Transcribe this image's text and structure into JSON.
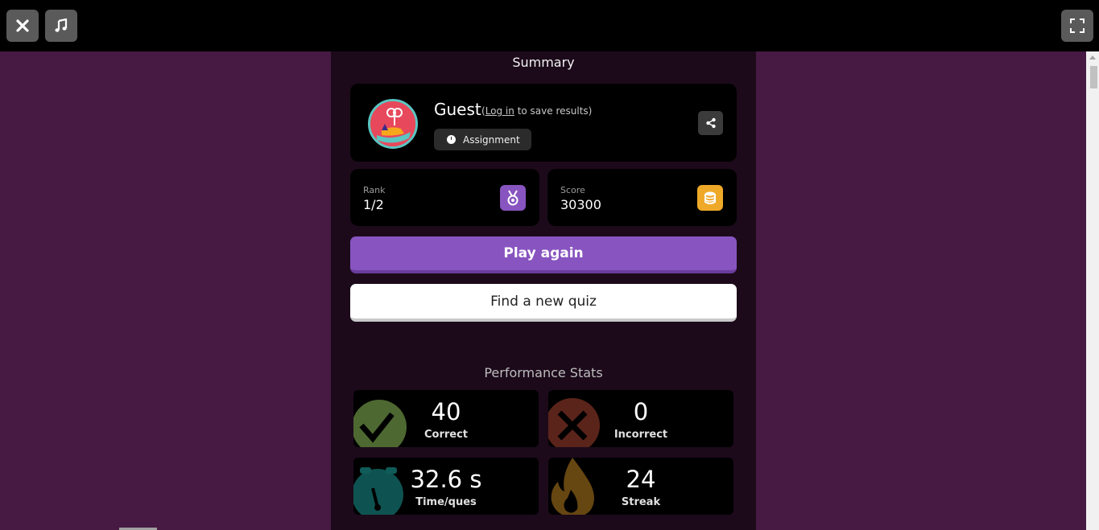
{
  "topbar": {
    "close_icon": "close-icon",
    "music_icon": "music-note-icon",
    "fullscreen_icon": "fullscreen-icon"
  },
  "summary": {
    "title": "Summary"
  },
  "profile": {
    "name": "Guest",
    "login_prefix": "(",
    "login_link": "Log in",
    "login_suffix": " to save results)",
    "mode_label": "Assignment",
    "share_icon": "share-icon"
  },
  "rank": {
    "label": "Rank",
    "value": "1/2",
    "icon": "medal-icon",
    "icon_color": "#8854c0"
  },
  "score": {
    "label": "Score",
    "value": "30300",
    "icon": "coins-icon",
    "icon_color": "#efa929"
  },
  "actions": {
    "play_again": "Play again",
    "find_quiz": "Find a new quiz",
    "play_color": "#8854c0"
  },
  "performance": {
    "title": "Performance Stats",
    "correct": {
      "value": "40",
      "label": "Correct"
    },
    "incorrect": {
      "value": "0",
      "label": "Incorrect"
    },
    "time": {
      "value": "32.6 s",
      "label": "Time/ques"
    },
    "streak": {
      "value": "24",
      "label": "Streak"
    }
  }
}
